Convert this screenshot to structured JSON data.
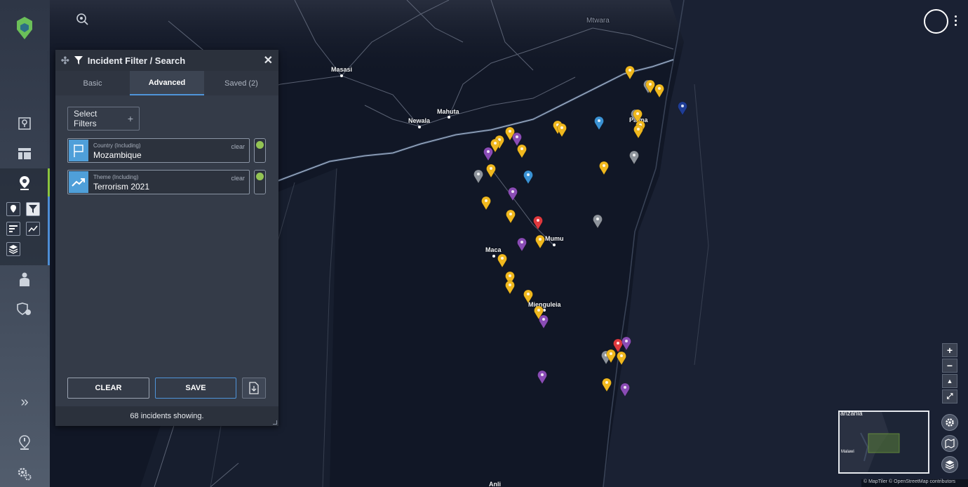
{
  "panel": {
    "title": "Incident Filter / Search",
    "tabs": [
      {
        "label": "Basic",
        "active": false
      },
      {
        "label": "Advanced",
        "active": true
      },
      {
        "label": "Saved (2)",
        "active": false
      }
    ],
    "select_filters_label": "Select Filters",
    "filters": [
      {
        "label": "Country (Including)",
        "value": "Mozambique",
        "clear": "clear",
        "icon": "flag-icon",
        "enabled": true
      },
      {
        "label": "Theme (Including)",
        "value": "Terrorism 2021",
        "clear": "clear",
        "icon": "trend-icon",
        "enabled": true
      }
    ],
    "clear_button": "CLEAR",
    "save_button": "SAVE",
    "status": "68 incidents showing."
  },
  "map": {
    "places": [
      "Mtwara",
      "Masasi",
      "Newala",
      "Mahuta",
      "Palma",
      "Mumu",
      "Maca",
      "Mienguleia",
      "Anli"
    ],
    "minimap_labels": [
      "anzania",
      "Malawi"
    ],
    "attribution": "© MapTiler © OpenStreetMap contributors",
    "marker_colors": {
      "yellow": "#f0b81e",
      "purple": "#8a4cb5",
      "grey": "#8e949c",
      "blue": "#3a92d4",
      "red": "#e0393e",
      "navy": "#1f3d96"
    }
  },
  "sidebar": {
    "accent": "#8cc63f"
  }
}
